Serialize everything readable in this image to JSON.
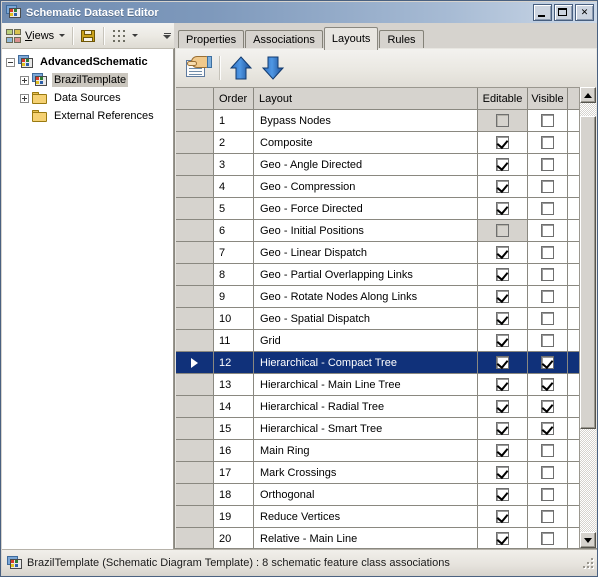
{
  "window": {
    "title": "Schematic Dataset Editor",
    "icon": "schematic-dataset-icon",
    "minimize_label": "_",
    "maximize_label": "□",
    "close_label": "×"
  },
  "toolbar_left": {
    "views_label": "Views",
    "views_icon": "views-icon",
    "save_icon": "save-icon",
    "layout_icon": "dotted-grid-icon",
    "overflow_icon": "toolbar-overflow-icon"
  },
  "tabs": [
    {
      "label": "Properties",
      "active": false
    },
    {
      "label": "Associations",
      "active": false
    },
    {
      "label": "Layouts",
      "active": true
    },
    {
      "label": "Rules",
      "active": false
    }
  ],
  "tree": {
    "nodes": [
      {
        "label": "AdvancedSchematic",
        "icon": "schematic-dataset-icon",
        "expander": "minus",
        "indent": 0,
        "bold": true,
        "selected": false
      },
      {
        "label": "BrazilTemplate",
        "icon": "schematic-diagram-template-icon",
        "expander": "plus",
        "indent": 1,
        "bold": false,
        "selected": true
      },
      {
        "label": "Data Sources",
        "icon": "folder-icon",
        "expander": "plus",
        "indent": 1,
        "bold": false,
        "selected": false
      },
      {
        "label": "External References",
        "icon": "folder-icon",
        "expander": "none",
        "indent": 1,
        "bold": false,
        "selected": false
      }
    ]
  },
  "grid_toolbar": {
    "properties_icon": "layout-properties-icon",
    "move_up_icon": "arrow-up-icon",
    "move_down_icon": "arrow-down-icon"
  },
  "grid": {
    "columns": [
      "",
      "Order",
      "Layout",
      "Editable",
      "Visible"
    ],
    "rows": [
      {
        "order": "1",
        "layout": "Bypass Nodes",
        "editable": false,
        "visible": false,
        "editable_disabled": true,
        "selected": false
      },
      {
        "order": "2",
        "layout": "Composite",
        "editable": true,
        "visible": false,
        "editable_disabled": false,
        "selected": false
      },
      {
        "order": "3",
        "layout": "Geo - Angle Directed",
        "editable": true,
        "visible": false,
        "editable_disabled": false,
        "selected": false
      },
      {
        "order": "4",
        "layout": "Geo - Compression",
        "editable": true,
        "visible": false,
        "editable_disabled": false,
        "selected": false
      },
      {
        "order": "5",
        "layout": "Geo - Force Directed",
        "editable": true,
        "visible": false,
        "editable_disabled": false,
        "selected": false
      },
      {
        "order": "6",
        "layout": "Geo - Initial Positions",
        "editable": false,
        "visible": false,
        "editable_disabled": true,
        "selected": false
      },
      {
        "order": "7",
        "layout": "Geo - Linear Dispatch",
        "editable": true,
        "visible": false,
        "editable_disabled": false,
        "selected": false
      },
      {
        "order": "8",
        "layout": "Geo - Partial Overlapping Links",
        "editable": true,
        "visible": false,
        "editable_disabled": false,
        "selected": false
      },
      {
        "order": "9",
        "layout": "Geo - Rotate Nodes Along Links",
        "editable": true,
        "visible": false,
        "editable_disabled": false,
        "selected": false
      },
      {
        "order": "10",
        "layout": "Geo - Spatial Dispatch",
        "editable": true,
        "visible": false,
        "editable_disabled": false,
        "selected": false
      },
      {
        "order": "11",
        "layout": "Grid",
        "editable": true,
        "visible": false,
        "editable_disabled": false,
        "selected": false
      },
      {
        "order": "12",
        "layout": "Hierarchical - Compact Tree",
        "editable": true,
        "visible": true,
        "editable_disabled": false,
        "selected": true
      },
      {
        "order": "13",
        "layout": "Hierarchical - Main Line Tree",
        "editable": true,
        "visible": true,
        "editable_disabled": false,
        "selected": false
      },
      {
        "order": "14",
        "layout": "Hierarchical - Radial Tree",
        "editable": true,
        "visible": true,
        "editable_disabled": false,
        "selected": false
      },
      {
        "order": "15",
        "layout": "Hierarchical - Smart Tree",
        "editable": true,
        "visible": true,
        "editable_disabled": false,
        "selected": false
      },
      {
        "order": "16",
        "layout": "Main Ring",
        "editable": true,
        "visible": false,
        "editable_disabled": false,
        "selected": false
      },
      {
        "order": "17",
        "layout": "Mark Crossings",
        "editable": true,
        "visible": false,
        "editable_disabled": false,
        "selected": false
      },
      {
        "order": "18",
        "layout": "Orthogonal",
        "editable": true,
        "visible": false,
        "editable_disabled": false,
        "selected": false
      },
      {
        "order": "19",
        "layout": "Reduce Vertices",
        "editable": true,
        "visible": false,
        "editable_disabled": false,
        "selected": false
      },
      {
        "order": "20",
        "layout": "Relative - Main Line",
        "editable": true,
        "visible": false,
        "editable_disabled": false,
        "selected": false
      }
    ]
  },
  "scrollbar": {
    "up_icon": "scroll-up-icon",
    "down_icon": "scroll-down-icon",
    "thumb_top_pct": 3,
    "thumb_height_pct": 73
  },
  "statusbar": {
    "icon": "schematic-diagram-template-icon",
    "text": "BrazilTemplate (Schematic Diagram Template) : 8 schematic feature class associations",
    "grip": "resize-grip"
  },
  "colors": {
    "selection": "#10317a",
    "window_chrome": "#d6d3ce",
    "title_bar_start": "#6f8bb0",
    "title_bar_end": "#cdd9e8"
  }
}
